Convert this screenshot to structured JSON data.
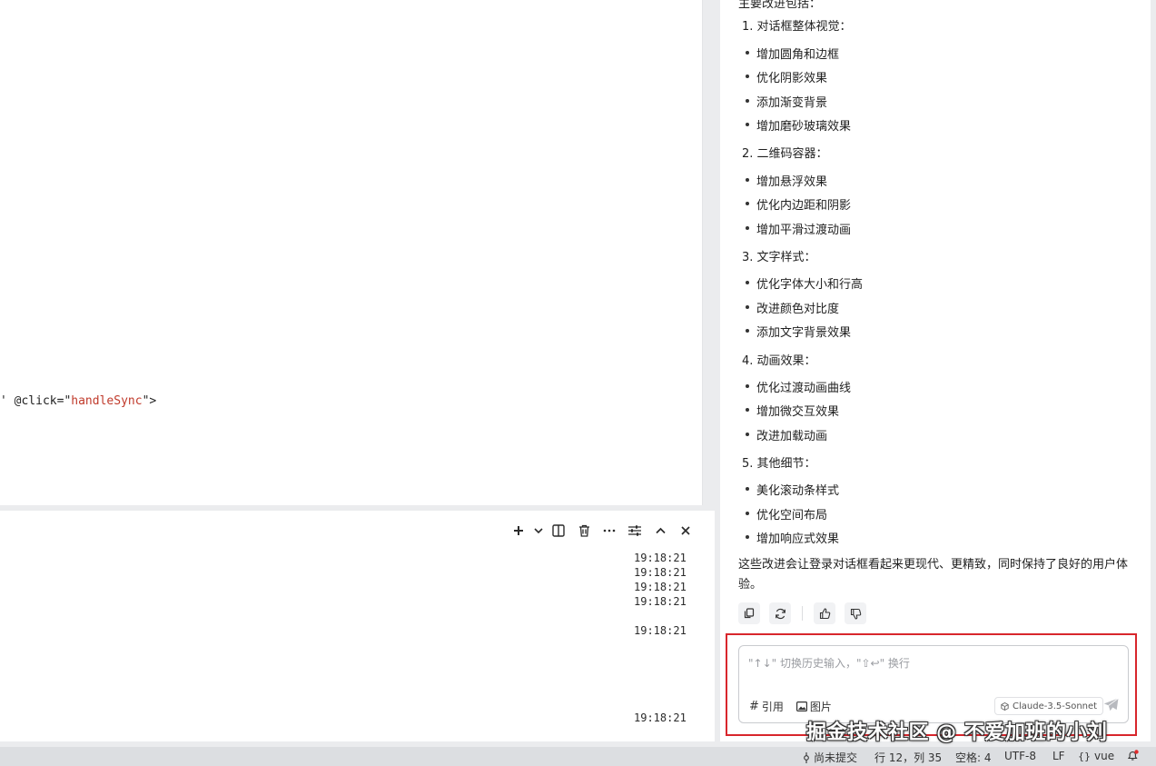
{
  "editor": {
    "code_prefix": "' @click=\"",
    "code_handler": "handleSync",
    "code_suffix": "\">"
  },
  "terminal": {
    "timestamps": [
      "19:18:21",
      "19:18:21",
      "19:18:21",
      "19:18:21",
      "19:18:21",
      "19:18:21"
    ]
  },
  "chat": {
    "cut_line": "主要改进包括：",
    "sections": [
      {
        "title": "1. 对话框整体视觉：",
        "items": [
          "增加圆角和边框",
          "优化阴影效果",
          "添加渐变背景",
          "增加磨砂玻璃效果"
        ]
      },
      {
        "title": "2. 二维码容器：",
        "items": [
          "增加悬浮效果",
          "优化内边距和阴影",
          "增加平滑过渡动画"
        ]
      },
      {
        "title": "3. 文字样式：",
        "items": [
          "优化字体大小和行高",
          "改进颜色对比度",
          "添加文字背景效果"
        ]
      },
      {
        "title": "4. 动画效果：",
        "items": [
          "优化过渡动画曲线",
          "增加微交互效果",
          "改进加载动画"
        ]
      },
      {
        "title": "5. 其他细节：",
        "items": [
          "美化滚动条样式",
          "优化空间布局",
          "增加响应式效果"
        ]
      }
    ],
    "summary": "这些改进会让登录对话框看起来更现代、更精致，同时保持了良好的用户体验。"
  },
  "input": {
    "placeholder": "\"↑↓\" 切换历史输入，\"⇧↩\" 换行",
    "quote_label": "引用",
    "image_label": "图片",
    "model": "Claude-3.5-Sonnet"
  },
  "statusbar": {
    "git": "尚未提交",
    "position": "行 12，列 35",
    "indent": "空格: 4",
    "encoding": "UTF-8",
    "eol": "LF",
    "language": "vue"
  },
  "watermark": "掘金技术社区 @ 不爱加班的小刘"
}
